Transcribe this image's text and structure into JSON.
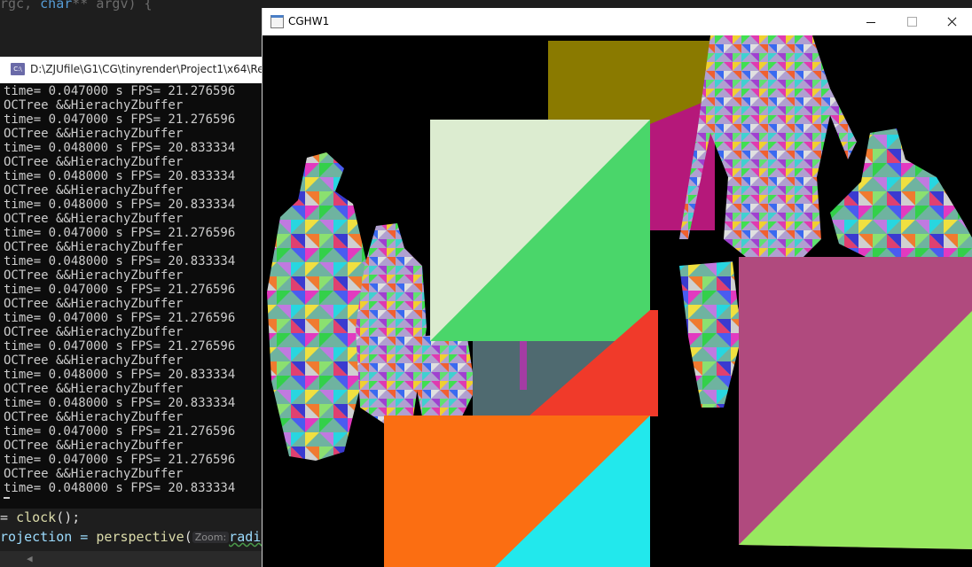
{
  "editor": {
    "top_line": {
      "a": "rgc, ",
      "b": "char",
      "c": "** argv) {"
    },
    "partial_line": "",
    "clock_line": {
      "a": "= ",
      "b": "clock",
      "c": "();"
    },
    "projection_line": {
      "a": "rojection = ",
      "b": "perspective",
      "c": "(",
      "hint": "Zoom:",
      "d": "radians"
    }
  },
  "console": {
    "title": "D:\\ZJUfile\\G1\\CG\\tinyrender\\Project1\\x64\\Re",
    "icon_label": "C:\\",
    "lines": [
      "time= 0.047000 s FPS= 21.276596",
      "OCTree &&HierachyZbuffer",
      "time= 0.047000 s FPS= 21.276596",
      "OCTree &&HierachyZbuffer",
      "time= 0.048000 s FPS= 20.833334",
      "OCTree &&HierachyZbuffer",
      "time= 0.048000 s FPS= 20.833334",
      "OCTree &&HierachyZbuffer",
      "time= 0.048000 s FPS= 20.833334",
      "OCTree &&HierachyZbuffer",
      "time= 0.047000 s FPS= 21.276596",
      "OCTree &&HierachyZbuffer",
      "time= 0.048000 s FPS= 20.833334",
      "OCTree &&HierachyZbuffer",
      "time= 0.047000 s FPS= 21.276596",
      "OCTree &&HierachyZbuffer",
      "time= 0.047000 s FPS= 21.276596",
      "OCTree &&HierachyZbuffer",
      "time= 0.047000 s FPS= 21.276596",
      "OCTree &&HierachyZbuffer",
      "time= 0.048000 s FPS= 20.833334",
      "OCTree &&HierachyZbuffer",
      "time= 0.048000 s FPS= 20.833334",
      "OCTree &&HierachyZbuffer",
      "time= 0.047000 s FPS= 21.276596",
      "OCTree &&HierachyZbuffer",
      "time= 0.047000 s FPS= 21.276596",
      "OCTree &&HierachyZbuffer",
      "time= 0.048000 s FPS= 20.833334"
    ]
  },
  "render_window": {
    "title": "CGHW1",
    "controls": {
      "minimize": "minimize-icon",
      "maximize": "maximize-icon",
      "close": "close-icon"
    },
    "scene_colors": {
      "olive": "#8a7a00",
      "magenta": "#b5187a",
      "mint": "#dcecd0",
      "green": "#4ad66a",
      "slate": "#4f6a70",
      "red_orange": "#f03a2a",
      "orange": "#fb6e12",
      "cyan": "#22e8ec",
      "mauve": "#b04a7e",
      "lime": "#98e860",
      "purple": "#a43ca4"
    }
  }
}
